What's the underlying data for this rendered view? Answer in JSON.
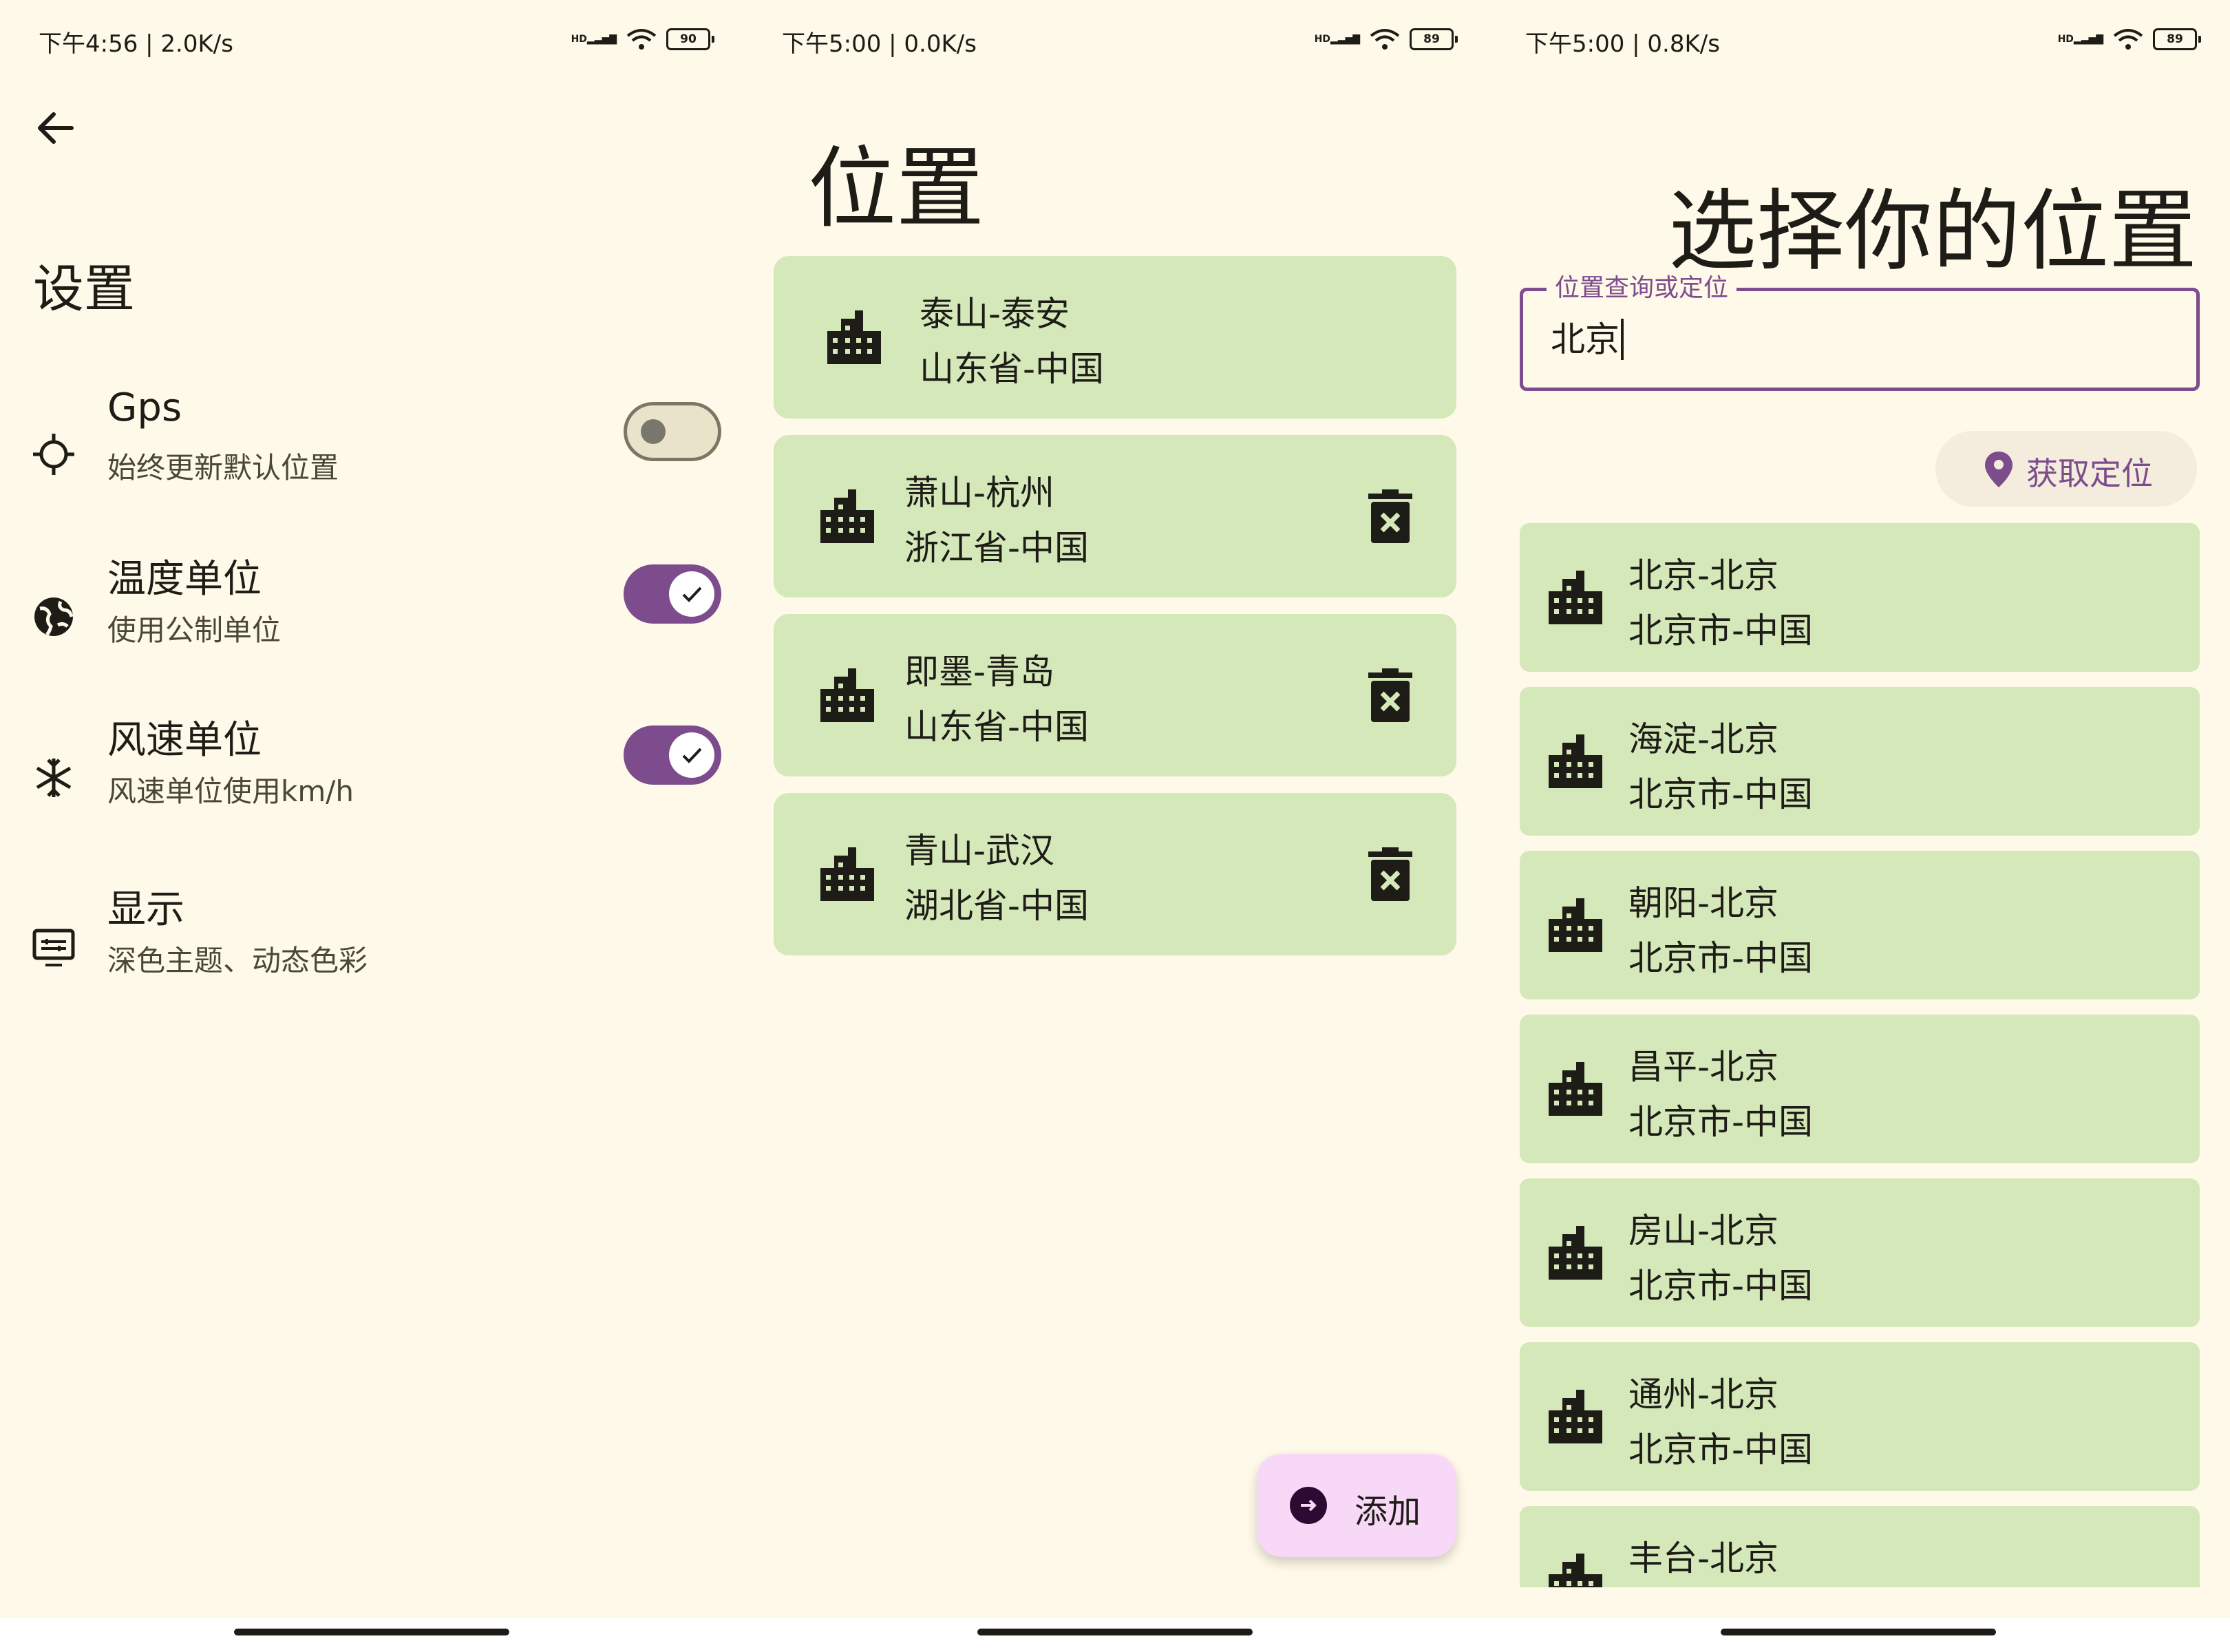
{
  "colors": {
    "background": "#fef9e8",
    "card": "#d5e8ba",
    "accent": "#7d4c8c",
    "fab": "#f8d8f7"
  },
  "screen1": {
    "status": {
      "text": "下午4:56 | 2.0K/s",
      "battery": "90"
    },
    "title": "设置",
    "settings": [
      {
        "icon": "gps-crosshair-icon",
        "title": "Gps",
        "subtitle": "始终更新默认位置",
        "toggle": "off"
      },
      {
        "icon": "globe-icon",
        "title": "温度单位",
        "subtitle": "使用公制单位",
        "toggle": "on"
      },
      {
        "icon": "snowflake-icon",
        "title": "风速单位",
        "subtitle": "风速单位使用km/h",
        "toggle": "on"
      },
      {
        "icon": "display-settings-icon",
        "title": "显示",
        "subtitle": "深色主题、动态色彩"
      }
    ]
  },
  "screen2": {
    "status": {
      "text": "下午5:00 | 0.0K/s",
      "battery": "89"
    },
    "title": "位置",
    "locations": [
      {
        "line1": "泰山-泰安",
        "line2": "山东省-中国",
        "deletable": false
      },
      {
        "line1": "萧山-杭州",
        "line2": "浙江省-中国",
        "deletable": true
      },
      {
        "line1": "即墨-青岛",
        "line2": "山东省-中国",
        "deletable": true
      },
      {
        "line1": "青山-武汉",
        "line2": "湖北省-中国",
        "deletable": true
      }
    ],
    "fab_label": "添加"
  },
  "screen3": {
    "status": {
      "text": "下午5:00 | 0.8K/s",
      "battery": "89"
    },
    "title": "选择你的位置",
    "search": {
      "label": "位置查询或定位",
      "value": "北京"
    },
    "locate_button": "获取定位",
    "results": [
      {
        "line1": "北京-北京",
        "line2": "北京市-中国"
      },
      {
        "line1": "海淀-北京",
        "line2": "北京市-中国"
      },
      {
        "line1": "朝阳-北京",
        "line2": "北京市-中国"
      },
      {
        "line1": "昌平-北京",
        "line2": "北京市-中国"
      },
      {
        "line1": "房山-北京",
        "line2": "北京市-中国"
      },
      {
        "line1": "通州-北京",
        "line2": "北京市-中国"
      },
      {
        "line1": "丰台-北京",
        "line2": ""
      }
    ]
  }
}
